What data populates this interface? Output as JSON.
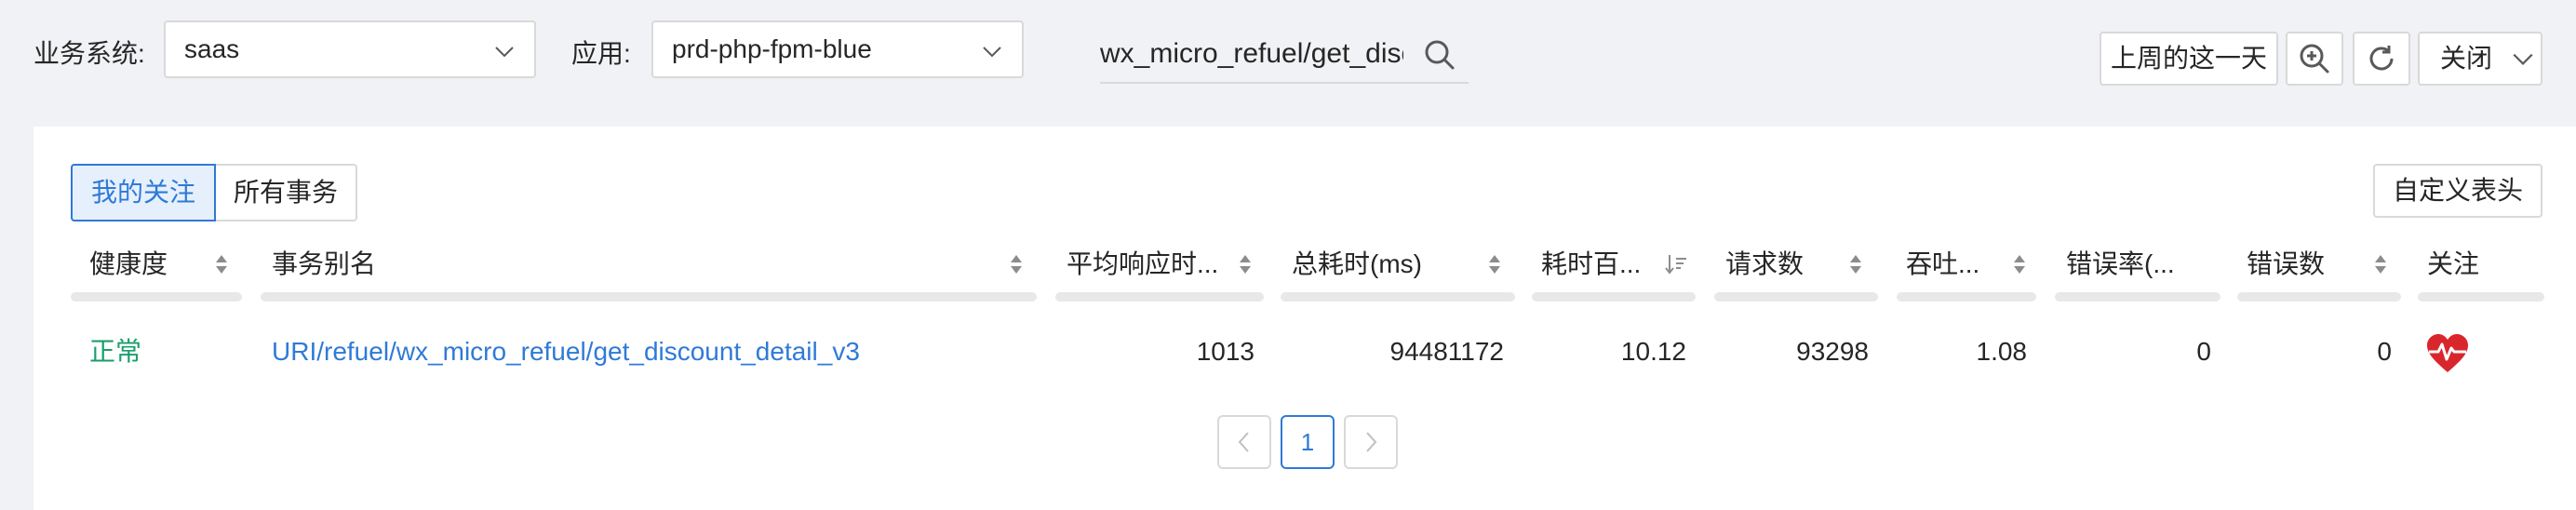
{
  "filters": {
    "system_label": "业务系统:",
    "system_value": "saas",
    "app_label": "应用:",
    "app_value": "prd-php-fpm-blue",
    "search_value": "wx_micro_refuel/get_disc"
  },
  "toolbar": {
    "last_week_label": "上周的这一天",
    "close_label": "关闭"
  },
  "tabs": {
    "followed": "我的关注",
    "all": "所有事务"
  },
  "custom_header_label": "自定义表头",
  "table": {
    "headers": {
      "health": "健康度",
      "alias": "事务别名",
      "avg_resp": "平均响应时...",
      "total_time": "总耗时(ms)",
      "time_pct": "耗时百...",
      "requests": "请求数",
      "throughput": "吞吐...",
      "error_rate": "错误率(...",
      "errors": "错误数",
      "follow": "关注"
    },
    "rows": [
      {
        "health": "正常",
        "alias": "URI/refuel/wx_micro_refuel/get_discount_detail_v3",
        "avg_resp": "1013",
        "total_time": "94481172",
        "time_pct": "10.12",
        "requests": "93298",
        "throughput": "1.08",
        "error_rate": "0",
        "errors": "0",
        "follow_icon": "heart-pulse-icon"
      }
    ]
  },
  "pagination": {
    "current": "1"
  },
  "colors": {
    "accent": "#2f7ad6",
    "healthy": "#1a9e6b",
    "heart": "#d9262c"
  }
}
